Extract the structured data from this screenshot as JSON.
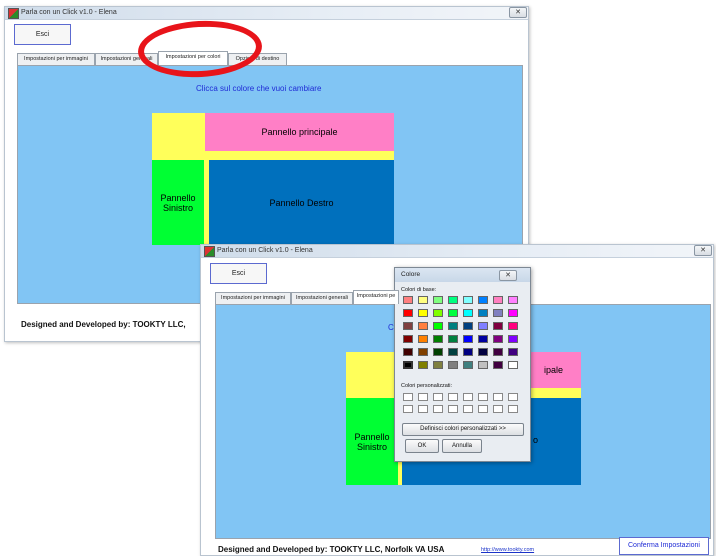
{
  "back_window": {
    "title": "Parla con un Click v1.0 - Elena",
    "close_label": "✕",
    "exit_label": "Esci",
    "tabs": [
      "Impostazioni per immagini",
      "Impostazioni generali",
      "Impostazioni per colori",
      "Opzioni di destino"
    ],
    "instruction": "Clicca sul colore che vuoi cambiare",
    "panels": {
      "main": "Pannello principale",
      "left": "Pannello Sinistro",
      "right": "Pannello Destro"
    },
    "footer": "Designed and Developed by: TOOKTY LLC,"
  },
  "front_window": {
    "title": "Parla con un Click v1.0 - Elena",
    "close_label": "✕",
    "exit_label": "Esci",
    "tabs": [
      "Impostazioni per immagini",
      "Impostazioni generali",
      "Impostazioni pe"
    ],
    "instruction_partial": "Cl",
    "panels": {
      "main_partial": "ipale",
      "left": "Pannello Sinistro",
      "right_partial": "o"
    },
    "footer": "Designed and Developed by: TOOKTY LLC, Norfolk VA USA",
    "link": "http://www.tookty.com",
    "confirm_label": "Conferma Impostazioni"
  },
  "color_dialog": {
    "title": "Colore",
    "close_label": "✕",
    "basic_colors_label": "Colori di base:",
    "custom_colors_label": "Colori personalizzati:",
    "define_custom_label": "Definisci colori personalizzati >>",
    "ok_label": "OK",
    "cancel_label": "Annulla",
    "basic_colors": [
      [
        "#ff8080",
        "#ffff80",
        "#80ff80",
        "#00ff80",
        "#80ffff",
        "#0080ff",
        "#ff80c0",
        "#ff80ff"
      ],
      [
        "#ff0000",
        "#ffff00",
        "#80ff00",
        "#00ff40",
        "#00ffff",
        "#0080c0",
        "#8080c0",
        "#ff00ff"
      ],
      [
        "#804040",
        "#ff8040",
        "#00ff00",
        "#008080",
        "#004080",
        "#8080ff",
        "#800040",
        "#ff0080"
      ],
      [
        "#800000",
        "#ff8000",
        "#008000",
        "#008040",
        "#0000ff",
        "#0000a0",
        "#800080",
        "#8000ff"
      ],
      [
        "#400000",
        "#804000",
        "#004000",
        "#004040",
        "#000080",
        "#000040",
        "#400040",
        "#400080"
      ],
      [
        "#000000",
        "#808000",
        "#808040",
        "#808080",
        "#408080",
        "#c0c0c0",
        "#400040",
        "#ffffff"
      ]
    ]
  },
  "colors": {
    "panel_bg": "#81c5f4",
    "yellow": "#ffff5a",
    "pink": "#ff7fc6",
    "green": "#00ff33",
    "blue": "#0070bd",
    "highlight": "#e8141a"
  }
}
